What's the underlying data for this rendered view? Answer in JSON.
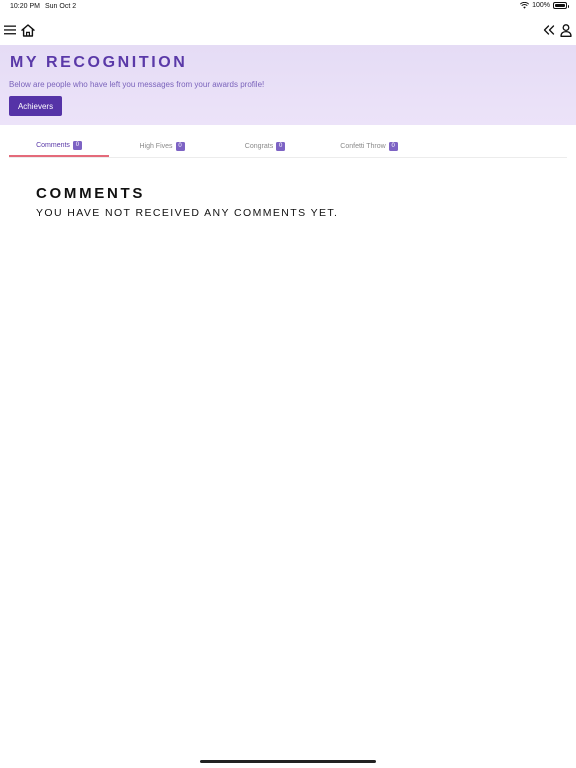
{
  "status_bar": {
    "time": "10:20 PM",
    "date": "Sun Oct 2",
    "battery": "100%"
  },
  "header": {
    "title": "MY RECOGNITION",
    "subtitle": "Below are people who have left you messages from your awards profile!",
    "achievers_label": "Achievers"
  },
  "tabs": [
    {
      "label": "Comments",
      "count": "0",
      "active": true
    },
    {
      "label": "High Fives",
      "count": "0",
      "active": false
    },
    {
      "label": "Congrats",
      "count": "0",
      "active": false
    },
    {
      "label": "Confetti Throw",
      "count": "0",
      "active": false
    }
  ],
  "content": {
    "section_title": "COMMENTS",
    "empty_message": "YOU HAVE NOT RECEIVED ANY COMMENTS YET."
  },
  "colors": {
    "brand_purple": "#5533a7",
    "header_bg": "#e5dcf5",
    "active_tab_underline": "#e46a7a"
  },
  "icons": {
    "menu": "hamburger-menu-icon",
    "home": "home-icon",
    "collapse": "double-chevron-left-icon",
    "user": "user-profile-icon",
    "wifi": "wifi-icon",
    "battery": "battery-icon"
  }
}
